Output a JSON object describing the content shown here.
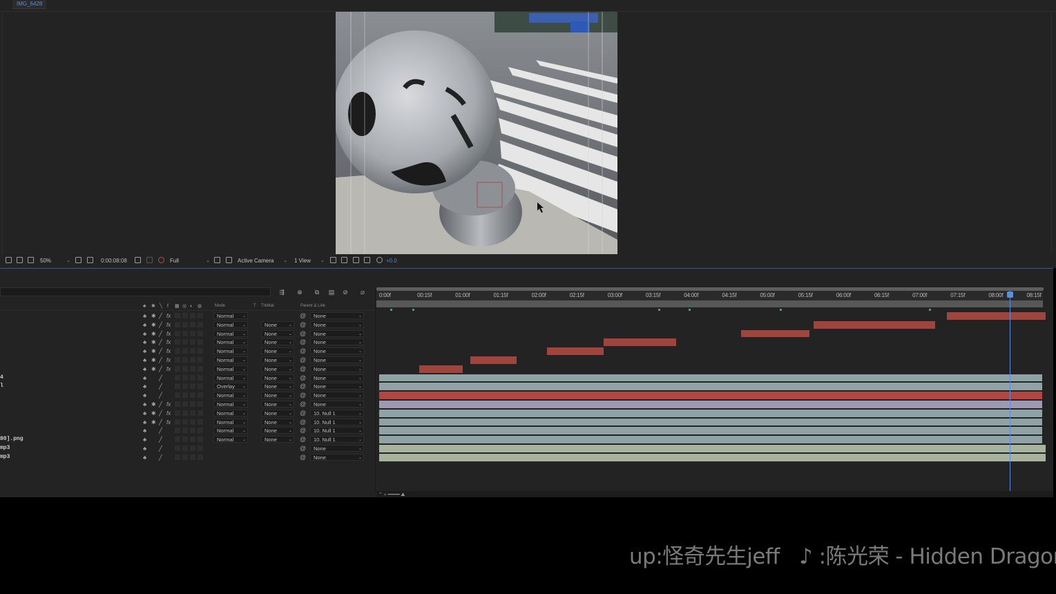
{
  "composition": {
    "tab_label": "IMG_6428"
  },
  "viewer_toolbar": {
    "zoom": "50%",
    "timecode": "0:00:08:08",
    "resolution": "Full",
    "camera": "Active Camera",
    "views": "1 View",
    "exposure": "+0.0",
    "icons": [
      "always-preview-icon",
      "monitor-icon",
      "glasses-icon",
      "region-icon",
      "transparency-grid-icon",
      "snapshot-icon",
      "show-snapshot-icon",
      "color-channel-icon",
      "fast-preview-icon",
      "3d-renderer-icon",
      "reset-exposure-icon"
    ]
  },
  "timeline": {
    "headers": {
      "mode": "Mode",
      "t": "T",
      "trkmat": "TrkMat",
      "parent": "Parent & Link"
    },
    "tool_icons": [
      "shy-layers-icon",
      "frame-blending-icon",
      "motion-blur-icon",
      "graph-editor-icon",
      "comp-flowchart-icon"
    ],
    "ruler_ticks": [
      "0:00f",
      "00:15f",
      "01:00f",
      "01:15f",
      "02:00f",
      "02:15f",
      "03:00f",
      "03:15f",
      "04:00f",
      "04:15f",
      "05:00f",
      "05:15f",
      "06:00f",
      "06:15f",
      "07:00f",
      "07:15f",
      "08:00f",
      "08:15f"
    ],
    "layers": [
      {
        "name": "",
        "fx": true,
        "mode": "Normal",
        "trkmat": "",
        "parent": "None",
        "bar_color": "#a0453e",
        "bar_start": 7.45,
        "bar_end": 8.75
      },
      {
        "name": "",
        "fx": true,
        "mode": "Normal",
        "trkmat": "None",
        "parent": "None",
        "bar_color": "#a0453e",
        "bar_start": 5.7,
        "bar_end": 7.3
      },
      {
        "name": "",
        "fx": true,
        "mode": "Normal",
        "trkmat": "None",
        "parent": "None",
        "bar_color": "#a0453e",
        "bar_start": 4.75,
        "bar_end": 5.65
      },
      {
        "name": "",
        "fx": true,
        "mode": "Normal",
        "trkmat": "None",
        "parent": "None",
        "bar_color": "#a0453e",
        "bar_start": 2.95,
        "bar_end": 3.9
      },
      {
        "name": "",
        "fx": true,
        "mode": "Normal",
        "trkmat": "None",
        "parent": "None",
        "bar_color": "#a0453e",
        "bar_start": 2.2,
        "bar_end": 2.95
      },
      {
        "name": "",
        "fx": true,
        "mode": "Normal",
        "trkmat": "None",
        "parent": "None",
        "bar_color": "#a0453e",
        "bar_start": 1.2,
        "bar_end": 1.8
      },
      {
        "name": "",
        "fx": true,
        "mode": "Normal",
        "trkmat": "None",
        "parent": "None",
        "bar_color": "#a0453e",
        "bar_start": 0.53,
        "bar_end": 1.1
      },
      {
        "name": "4",
        "fx": false,
        "mode": "Normal",
        "trkmat": "None",
        "parent": "None",
        "bar_color": "#8fa3a6",
        "bar_start": 0.0,
        "bar_end": 8.7
      },
      {
        "name": "l",
        "fx": false,
        "mode": "Overlay",
        "trkmat": "None",
        "parent": "None",
        "bar_color": "#8fa3a6",
        "bar_start": 0.0,
        "bar_end": 8.7
      },
      {
        "name": "",
        "fx": false,
        "mode": "Normal",
        "trkmat": "None",
        "parent": "None",
        "bar_color": "#b24640",
        "bar_start": 0.0,
        "bar_end": 8.7
      },
      {
        "name": "",
        "fx": true,
        "mode": "Normal",
        "trkmat": "None",
        "parent": "None",
        "bar_color": "#9e98b3",
        "bar_start": 0.0,
        "bar_end": 8.7
      },
      {
        "name": "",
        "fx": true,
        "mode": "Normal",
        "trkmat": "None",
        "parent": "10. Null 1",
        "bar_color": "#8fa3a6",
        "bar_start": 0.0,
        "bar_end": 8.7
      },
      {
        "name": "",
        "fx": true,
        "mode": "Normal",
        "trkmat": "None",
        "parent": "10. Null 1",
        "bar_color": "#8fa3a6",
        "bar_start": 0.0,
        "bar_end": 8.7
      },
      {
        "name": "",
        "fx": false,
        "mode": "Normal",
        "trkmat": "None",
        "parent": "10. Null 1",
        "bar_color": "#8fa3a6",
        "bar_start": 0.0,
        "bar_end": 8.7
      },
      {
        "name": "80].png",
        "fx": false,
        "mode": "Normal",
        "trkmat": "None",
        "parent": "10. Null 1",
        "bar_color": "#8fa3a6",
        "bar_start": 0.0,
        "bar_end": 8.7
      },
      {
        "name": "mp3",
        "fx": false,
        "mode": "",
        "trkmat": "",
        "parent": "None",
        "bar_color": "#a7b39d",
        "bar_start": 0.0,
        "bar_end": 8.75
      },
      {
        "name": "mp3",
        "fx": false,
        "mode": "",
        "trkmat": "",
        "parent": "None",
        "bar_color": "#a7b39d",
        "bar_start": 0.0,
        "bar_end": 8.75
      }
    ]
  },
  "subtitles": {
    "uploader": "up:怪奇先生jeff",
    "music": "♪ :陈光荣 - Hidden Dragon"
  }
}
